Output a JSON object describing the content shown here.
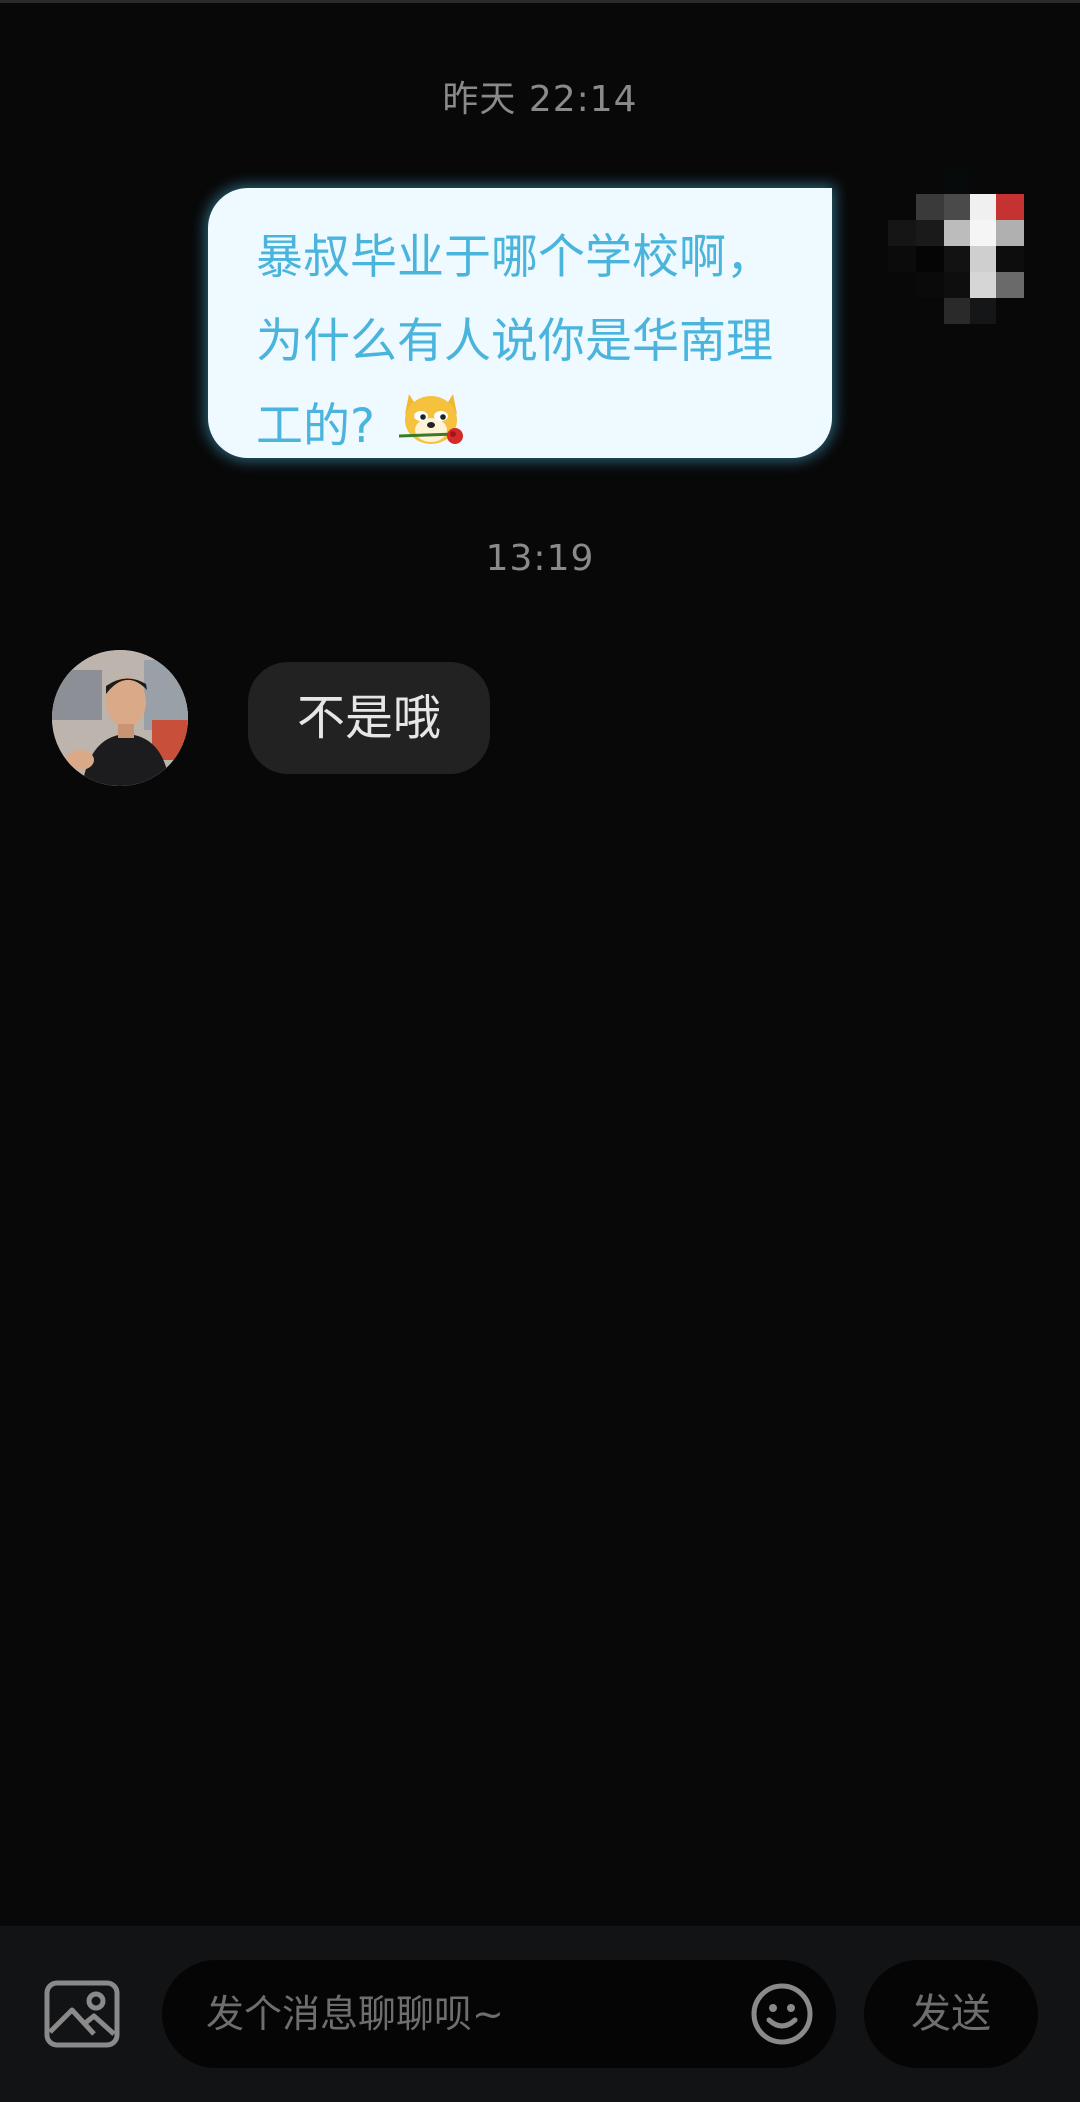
{
  "messages": {
    "timestamp_1": "昨天 22:14",
    "outgoing_text": "暴叔毕业于哪个学校啊，为什么有人说你是华南理工的?",
    "outgoing_emoji": "dog-with-rose-emoji",
    "timestamp_2": "13:19",
    "incoming_text": "不是哦"
  },
  "input_bar": {
    "placeholder": "发个消息聊聊呗~",
    "send_label": "发送",
    "image_icon": "image-icon",
    "emoji_icon": "smiley-icon"
  },
  "colors": {
    "background": "#080808",
    "outgoing_bubble": "#eefaff",
    "outgoing_text": "#4ab4dd",
    "incoming_bubble": "#222222"
  }
}
